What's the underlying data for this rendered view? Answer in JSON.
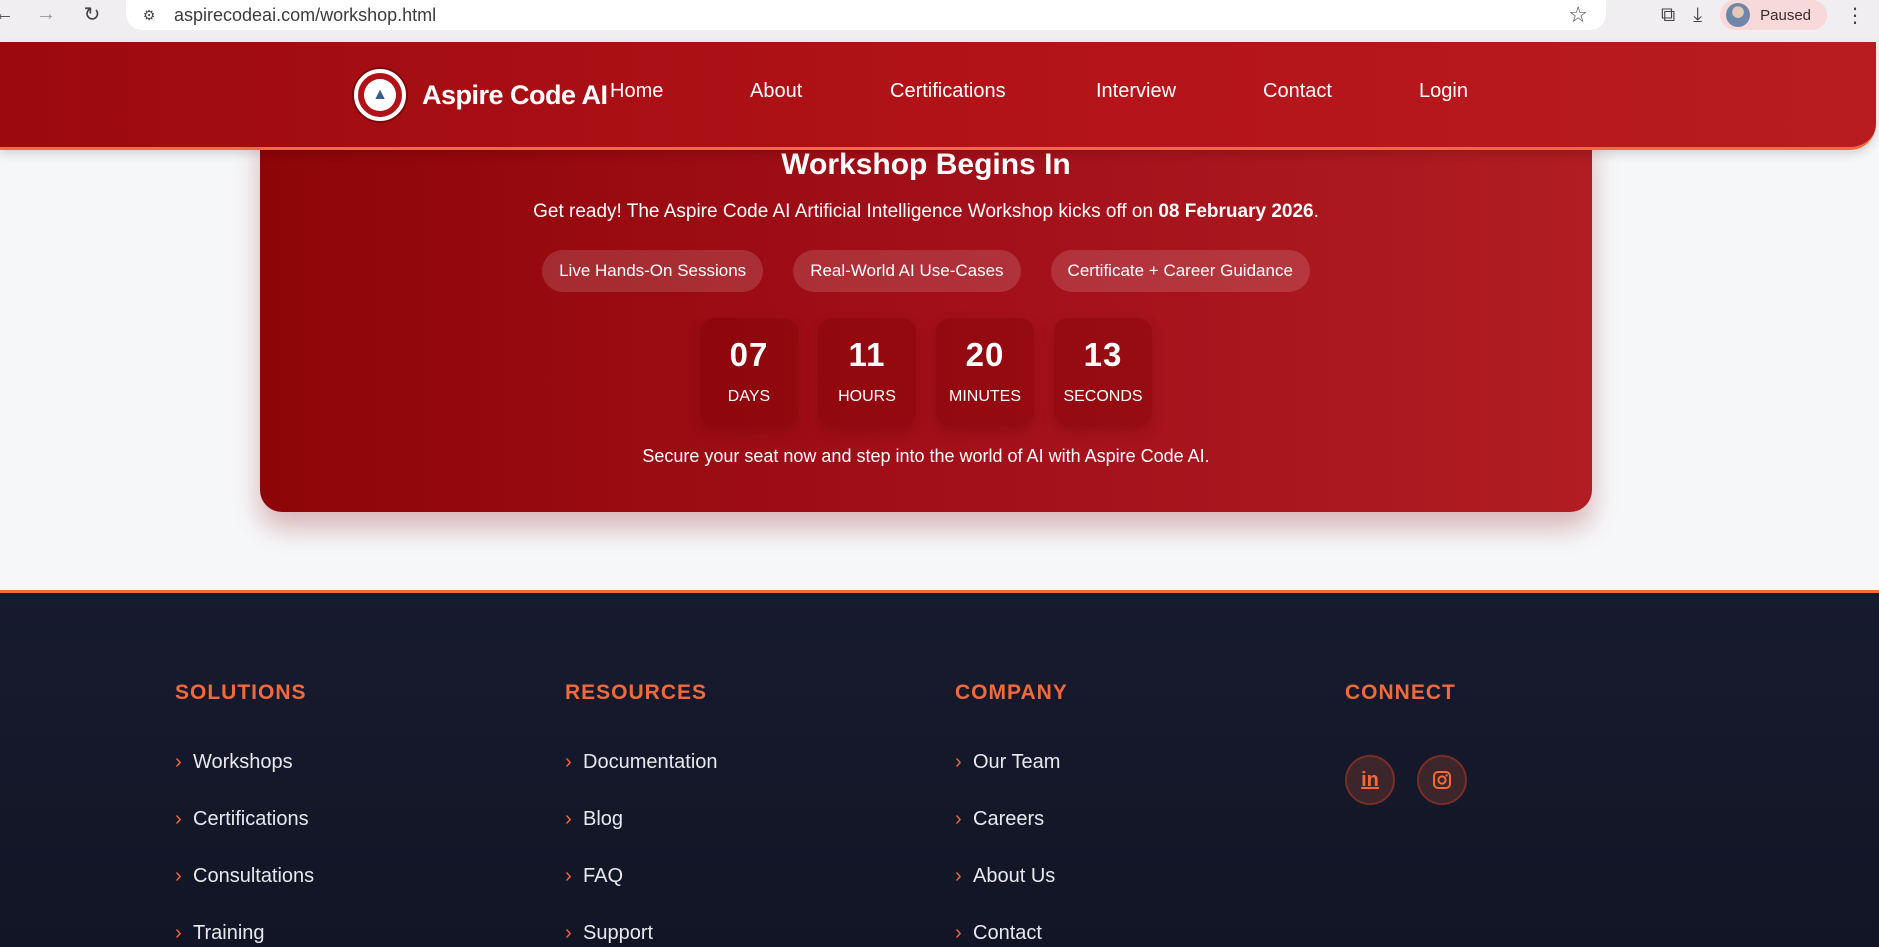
{
  "browser": {
    "url": "aspirecodeai.com/workshop.html",
    "profile_status": "Paused"
  },
  "header": {
    "brand": "Aspire Code AI",
    "nav": [
      "Home",
      "About",
      "Certifications",
      "Interview",
      "Contact",
      "Login"
    ]
  },
  "workshop": {
    "title": "Workshop Begins In",
    "subtitle_prefix": "Get ready! The Aspire Code AI Artificial Intelligence Workshop kicks off on ",
    "date": "08 February 2026",
    "subtitle_suffix": ".",
    "pills": [
      "Live Hands-On Sessions",
      "Real-World AI Use-Cases",
      "Certificate + Career Guidance"
    ],
    "countdown": [
      {
        "value": "07",
        "label": "DAYS"
      },
      {
        "value": "11",
        "label": "HOURS"
      },
      {
        "value": "20",
        "label": "MINUTES"
      },
      {
        "value": "13",
        "label": "SECONDS"
      }
    ],
    "footer_text": "Secure your seat now and step into the world of AI with Aspire Code AI."
  },
  "footer": {
    "solutions": {
      "title": "SOLUTIONS",
      "items": [
        "Workshops",
        "Certifications",
        "Consultations",
        "Training"
      ]
    },
    "resources": {
      "title": "RESOURCES",
      "items": [
        "Documentation",
        "Blog",
        "FAQ",
        "Support"
      ]
    },
    "company": {
      "title": "COMPANY",
      "items": [
        "Our Team",
        "Careers",
        "About Us",
        "Contact"
      ]
    },
    "connect": {
      "title": "CONNECT",
      "linkedin": "in",
      "instagram": "instagram-icon"
    }
  },
  "colors": {
    "header_red": "#b4141a",
    "accent_orange": "#f26a3a",
    "footer_navy": "#171b2e"
  }
}
